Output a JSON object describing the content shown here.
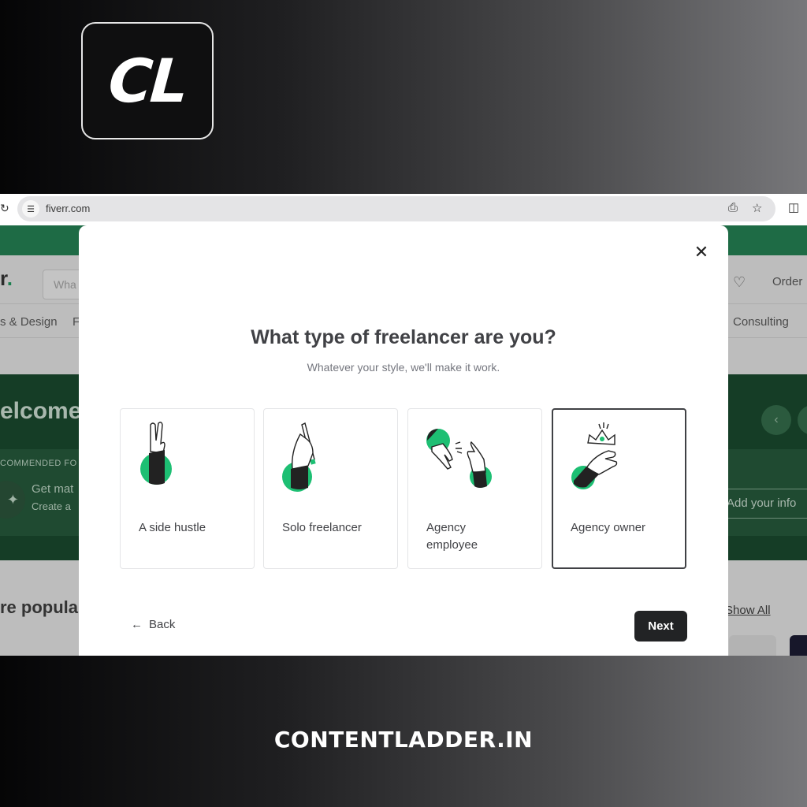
{
  "branding": {
    "logo_text": "CL",
    "footer_text": "CONTENTLADDER.IN"
  },
  "browser": {
    "url": "fiverr.com",
    "icons": [
      "site-info-icon",
      "install-app-icon",
      "bookmark-star-icon",
      "extensions-icon"
    ]
  },
  "background_page": {
    "logo_fragment": "r",
    "search_placeholder_fragment": "Wha",
    "header_orders": "Order",
    "categories": [
      "s & Design",
      "F",
      "Consulting"
    ],
    "welcome_fragment": "elcome",
    "recommended_label": "COMMENDED FO",
    "recommended_title": "Get mat",
    "recommended_sub": "Create a",
    "add_info_label": "Add your info",
    "popular_heading": "re popula",
    "show_all_link": "Show All"
  },
  "modal": {
    "title": "What type of freelancer are you?",
    "subtitle": "Whatever your style, we'll make it work.",
    "options": [
      {
        "label": "A side hustle",
        "icon": "peace-sign-hand-icon",
        "selected": false
      },
      {
        "label": "Solo freelancer",
        "icon": "hand-holding-pencil-icon",
        "selected": false
      },
      {
        "label": "Agency employee",
        "icon": "two-hands-snap-icon",
        "selected": false
      },
      {
        "label": "Agency owner",
        "icon": "hand-with-crown-icon",
        "selected": true
      }
    ],
    "back_label": "Back",
    "next_label": "Next"
  },
  "colors": {
    "accent_green": "#1dbf73",
    "dark_text": "#404145",
    "button_dark": "#222325",
    "fiverr_green_strip": "#1e6b45"
  }
}
